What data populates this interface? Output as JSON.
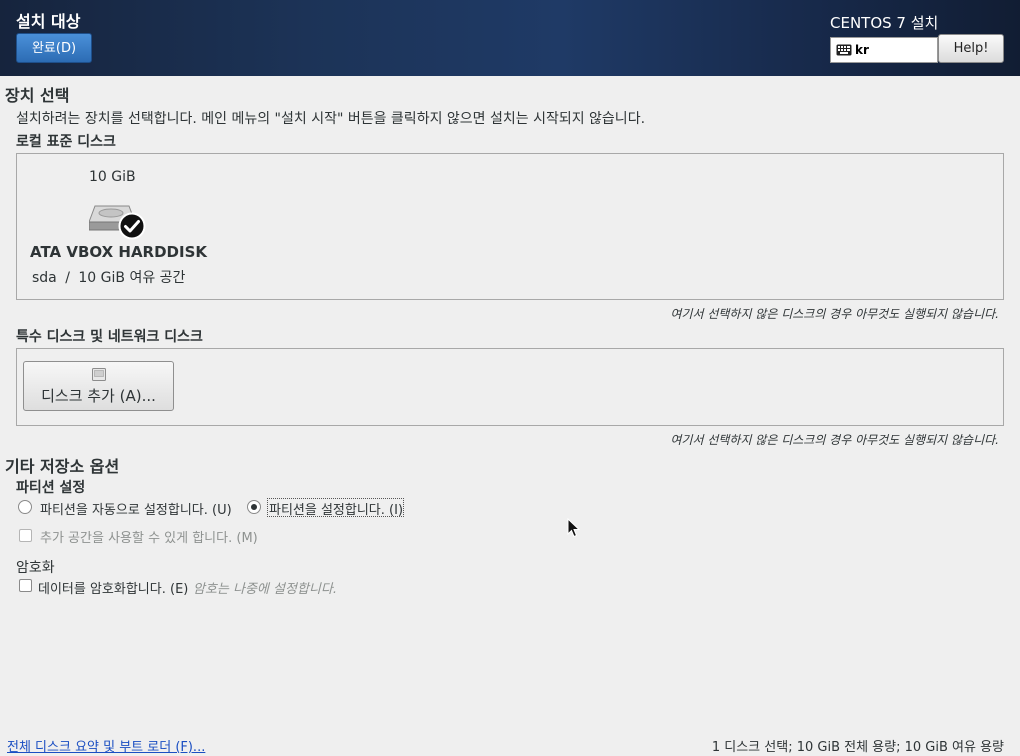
{
  "header": {
    "title": "설치 대상",
    "done_button": "완료(D)",
    "product": "CENTOS 7 설치",
    "keyboard_layout": "kr",
    "help_button": "Help!"
  },
  "device_selection": {
    "heading": "장치 선택",
    "description": "설치하려는 장치를 선택합니다. 메인 메뉴의 \"설치 시작\" 버튼을 클릭하지 않으면 설치는 시작되지 않습니다."
  },
  "local_disks": {
    "heading": "로컬 표준 디스크",
    "disk": {
      "size": "10 GiB",
      "name": "ATA VBOX HARDDISK",
      "device": "sda",
      "separator": "/",
      "free": "10 GiB 여유 공간",
      "selected": true
    },
    "note": "여기서 선택하지 않은 디스크의 경우 아무것도 실행되지 않습니다."
  },
  "special_disks": {
    "heading": "특수 디스크 및 네트워크 디스크",
    "add_button": "디스크 추가 (A)...",
    "note": "여기서 선택하지 않은 디스크의 경우 아무것도 실행되지 않습니다."
  },
  "other_options": {
    "heading": "기타 저장소 옵션",
    "partitioning": {
      "heading": "파티션 설정",
      "auto_label": "파티션을 자동으로 설정합니다. (U)",
      "manual_label": "파티션을 설정합니다. (I)",
      "selected": "manual",
      "extra_space_label": "추가 공간을 사용할 수 있게 합니다. (M)"
    },
    "encryption": {
      "heading": "암호화",
      "encrypt_label": "데이터를 암호화합니다. (E)",
      "hint": "암호는 나중에 설정합니다."
    }
  },
  "footer": {
    "summary_link": "전체 디스크 요약 및 부트 로더 (F)...",
    "status": "1 디스크 선택; 10 GiB 전체 용량; 10 GiB 여유 용량"
  },
  "colors": {
    "header_bg": "#1c3357",
    "accent": "#2c6cb4",
    "link": "#1a4ec2",
    "page_bg": "#efefef"
  }
}
